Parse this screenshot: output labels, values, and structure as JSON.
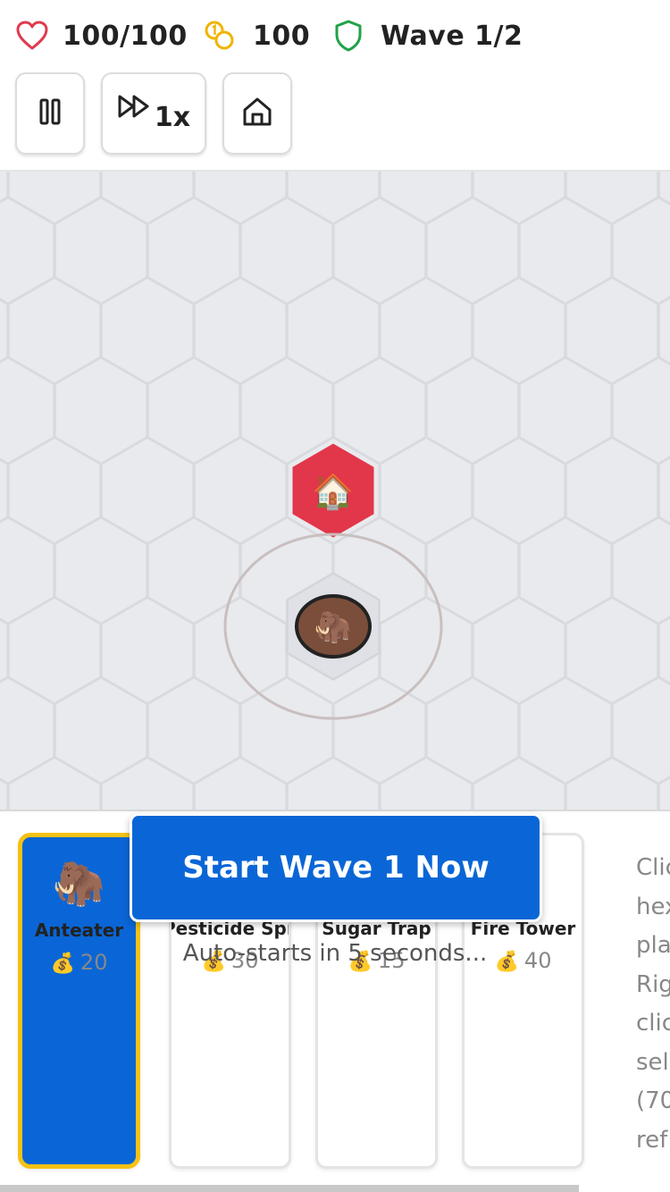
{
  "hud": {
    "lives": "100/100",
    "coins": "100",
    "wave": "Wave 1/2",
    "icons": {
      "lives": "heart-icon",
      "coins": "coins-icon",
      "wave": "shield-icon"
    },
    "colors": {
      "heart": "#e03a4e",
      "coins": "#f0b400",
      "shield": "#21a24a"
    }
  },
  "controls": {
    "pause_icon": "pause-icon",
    "speed_icon": "fast-forward-icon",
    "speed_label": "1x",
    "home_icon": "home-icon"
  },
  "map": {
    "base_tile_color": "#e2364a",
    "base_emoji": "🏠",
    "tower_emoji": "🦣",
    "background": "#e8eaed"
  },
  "towers": [
    {
      "emoji": "🦣",
      "name": "Anteater",
      "cost": "20",
      "selected": true
    },
    {
      "emoji": "",
      "name": "Pesticide Spray",
      "cost": "30",
      "selected": false
    },
    {
      "emoji": "",
      "name": "Sugar Trap",
      "cost": "15",
      "selected": false
    },
    {
      "emoji": "",
      "name": "Fire Tower",
      "cost": "40",
      "selected": false
    }
  ],
  "cost_icon": "💰",
  "wave_prompt": {
    "button_label": "Start Wave 1 Now",
    "auto_text": "Auto-starts in 5 seconds..."
  },
  "help_lines": [
    "Clic",
    "hex",
    "pla",
    "Rig",
    "clic",
    "sel",
    "(70",
    "ref"
  ],
  "accent_color": "#0a66d6",
  "selected_border_color": "#f5c214"
}
